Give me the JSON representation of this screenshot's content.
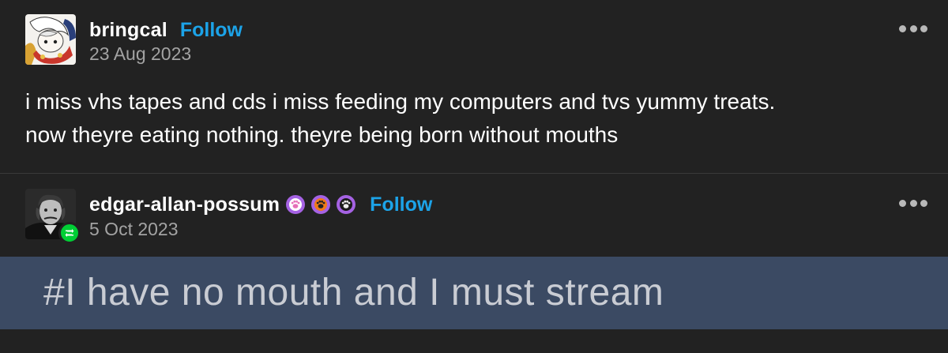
{
  "post1": {
    "username": "bringcal",
    "follow_label": "Follow",
    "date": "23 Aug 2023",
    "body_lines": [
      "i miss vhs tapes and cds i miss feeding my computers and tvs yummy treats.",
      "now theyre eating nothing. theyre being born without mouths"
    ]
  },
  "post2": {
    "username": "edgar-allan-possum",
    "follow_label": "Follow",
    "date": "5 Oct 2023",
    "tag": "#I have no mouth and I must stream",
    "badges": [
      "paw-pink-badge-icon",
      "paw-orange-badge-icon",
      "paw-dark-badge-icon"
    ]
  },
  "colors": {
    "background": "#222222",
    "follow": "#1ca3e8",
    "date": "#a3a3a3",
    "tag_strip": "#3b4a63",
    "reblog": "#00cf35"
  }
}
